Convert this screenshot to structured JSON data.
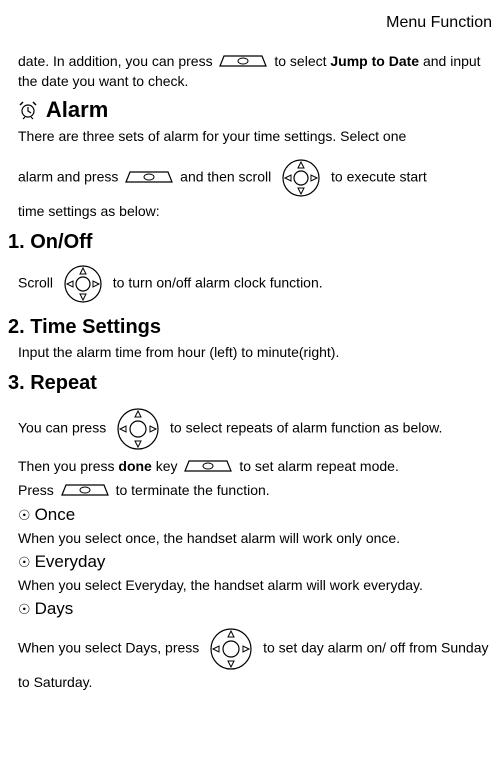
{
  "header": "Menu Function",
  "intro": {
    "part1": "date. In addition, you can press ",
    "part2": " to select ",
    "bold": "Jump to Date",
    "part3": " and input the date you want to check."
  },
  "alarm": {
    "title": "Alarm",
    "line1a": "There are three sets of alarm for your time settings. Select one",
    "line2a": "alarm and press ",
    "line2b": " and then scroll ",
    "line2c": " to execute start",
    "line3": "time settings as below:"
  },
  "onoff": {
    "title": "1. On/Off",
    "scroll_a": "Scroll ",
    "scroll_b": " to turn on/off alarm clock function."
  },
  "timesettings": {
    "title": "2. Time Settings",
    "body": "Input the alarm time from hour (left) to minute(right)."
  },
  "repeat": {
    "title": "3. Repeat",
    "line1a": "You can press ",
    "line1b": " to select repeats of alarm function as below.",
    "line2a": "Then you press ",
    "done": "done",
    "line2b": " key ",
    "line2c": " to set alarm repeat mode.",
    "line3a": "Press ",
    "line3b": " to terminate the function.",
    "once": {
      "title": "Once",
      "body": "When you select once, the handset alarm will work only once."
    },
    "everyday": {
      "title": "Everyday",
      "body": "When you select Everyday, the handset alarm will work everyday."
    },
    "days": {
      "title": "Days",
      "body_a": "When you select Days, press ",
      "body_b": " to set day alarm on/ off from Sunday to Saturday."
    }
  }
}
